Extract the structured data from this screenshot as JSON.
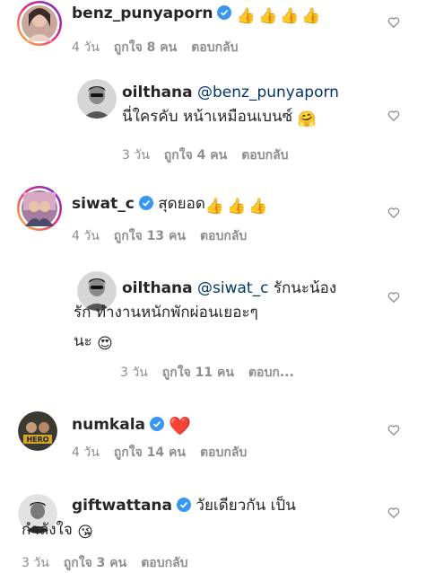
{
  "comments": [
    {
      "username": "benz_punyaporn",
      "verified": true,
      "text": "",
      "emoji_after": "👍👍👍👍",
      "time": "4 วัน",
      "likes": "ถูกใจ 8 คน",
      "reply": "ตอบกลับ"
    },
    {
      "username": "oilthana",
      "mention": "@benz_punyaporn",
      "line2": "นี่ใครคับ หน้าเหมือนเบนซ์",
      "emoji_after": "🤗",
      "time": "3 วัน",
      "likes": "ถูกใจ 4 คน",
      "reply": "ตอบกลับ"
    },
    {
      "username": "siwat_c",
      "verified": true,
      "text": "สุดยอด",
      "emoji_after": "👍👍👍",
      "time": "4 วัน",
      "likes": "ถูกใจ 13 คน",
      "reply": "ตอบกลับ"
    },
    {
      "username": "oilthana",
      "mention": "@siwat_c",
      "text": "รักนะน้อง",
      "line2": "รัก ทำงานหนักพักผ่อนเยอะๆ",
      "line3": "นะ",
      "emoji_after": "😍",
      "time": "3 วัน",
      "likes": "ถูกใจ 11 คน",
      "reply": "ตอบก..."
    },
    {
      "username": "numkala",
      "verified": true,
      "emoji_after": "❤️",
      "time": "4 วัน",
      "likes": "ถูกใจ 14 คน",
      "reply": "ตอบกลับ"
    },
    {
      "username": "giftwattana",
      "verified": true,
      "text": "วัยเดียวกัน เป็น",
      "line2": "กำลังใจ",
      "emoji_after": "😘",
      "time": "3 วัน",
      "likes": "ถูกใจ 3 คน",
      "reply": "ตอบกลับ"
    }
  ],
  "icons": {
    "like": "heart-outline-icon",
    "verified": "verified-badge-icon"
  },
  "colors": {
    "verified": "#3897f0",
    "mention": "#00376b",
    "meta": "#8e8e8e",
    "story_ring_start": "#f9ce34",
    "story_ring_end": "#c13584"
  }
}
